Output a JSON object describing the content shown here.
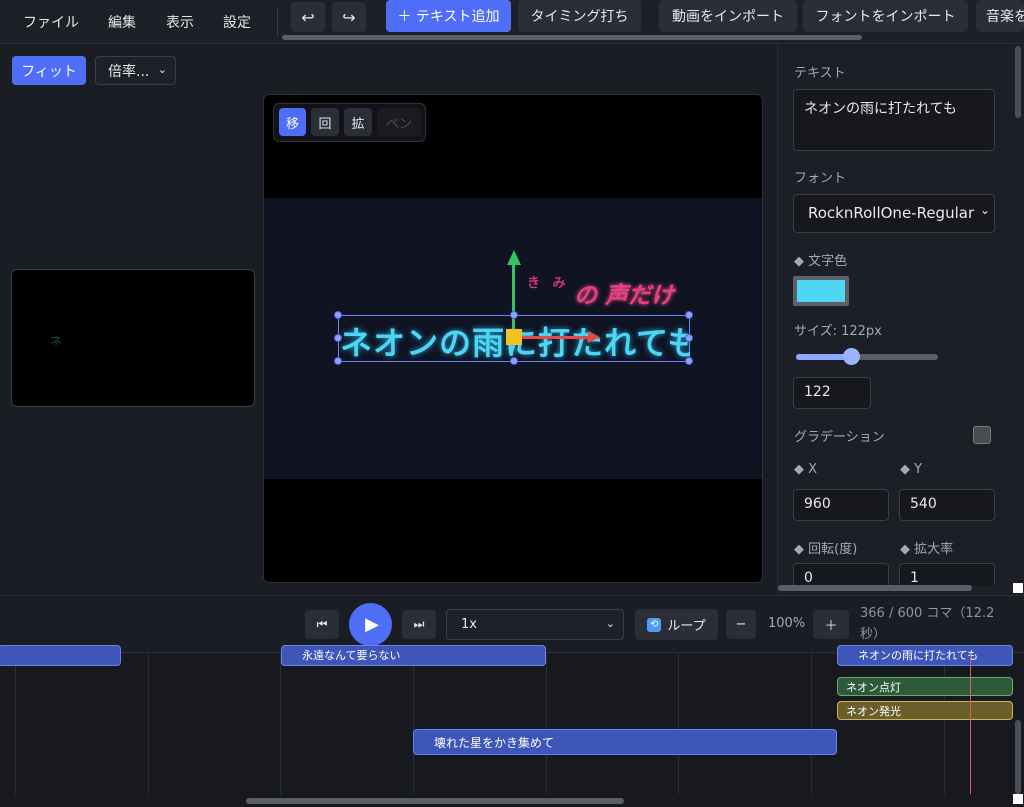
{
  "menu": [
    "ファイル",
    "編集",
    "表示",
    "設定"
  ],
  "toolbar": {
    "undo_icon": "↩",
    "redo_icon": "↪",
    "add_text": "＋ テキスト追加",
    "timing": "タイミング打ち",
    "import_video": "動画をインポート",
    "import_font": "フォントをインポート",
    "music": "音楽を"
  },
  "view": {
    "fit": "フィット",
    "zoom": "倍率..."
  },
  "tools": {
    "move": "移",
    "rotate": "回",
    "scale": "拡",
    "pen": "ペン"
  },
  "preview": {
    "overlay_small": "き み",
    "overlay_main": "の 声だけ",
    "main_text": "ネオンの雨に打たれても"
  },
  "panel": {
    "text_label": "テキスト",
    "text_value": "ネオンの雨に打たれても",
    "font_label": "フォント",
    "font_value": "RocknRollOne-Regular",
    "color_label": "◆ 文字色",
    "color_value": "#4dd6f2",
    "size_label": "サイズ: 122px",
    "size_fraction": 0.39,
    "size_value": "122",
    "gradient_label": "グラデーション",
    "x_label": "◆ X",
    "x_value": "960",
    "y_label": "◆ Y",
    "y_value": "540",
    "rotation_label": "◆ 回転(度)",
    "rotation_value": "0",
    "scale_label": "◆ 拡大率",
    "scale_value": "1"
  },
  "transport": {
    "prev_icon": "⏮",
    "play_icon": "▶",
    "next_icon": "⏭",
    "speed": "1x",
    "loop": "ループ",
    "minus": "−",
    "zoom": "100%",
    "plus": "＋",
    "frame_info": "366 / 600 コマ（12.2秒）"
  },
  "timeline": {
    "clip_top_center": "永遠なんて要らない",
    "clip_top_right": "ネオンの雨に打たれても",
    "clip_neon_on": "ネオン点灯",
    "clip_neon_glow": "ネオン発光",
    "clip_stars": "壊れた星をかき集めて"
  }
}
